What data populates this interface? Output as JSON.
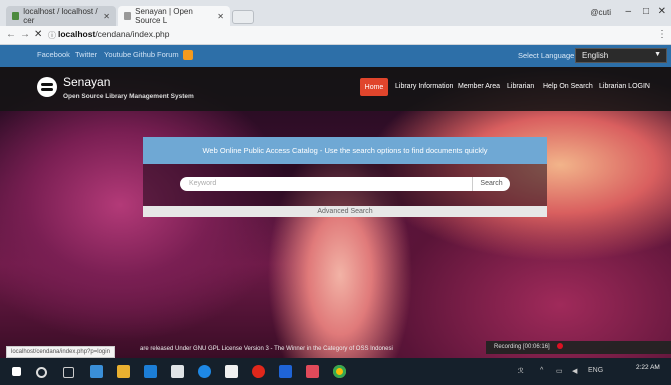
{
  "browser": {
    "tabs": [
      {
        "title": "localhost / localhost / cer"
      },
      {
        "title": "Senayan | Open Source L"
      }
    ],
    "user": "@cuti",
    "url": {
      "host": "localhost",
      "path": "/cendana/index.php"
    }
  },
  "social": {
    "links": [
      "Facebook",
      "Twitter",
      "Youtube",
      "Github",
      "Forum"
    ]
  },
  "language": {
    "label": "Select Language",
    "value": "English"
  },
  "header": {
    "brand": "Senayan",
    "tagline": "Open Source Library Management System",
    "nav": [
      "Home",
      "Library Information",
      "Member Area",
      "Librarian",
      "Help On Search",
      "Librarian LOGIN"
    ]
  },
  "search": {
    "heading": "Web Online Public Access Catalog - Use the search options to find documents quickly",
    "placeholder": "Keyword",
    "button": "Search",
    "advanced": "Advanced Search"
  },
  "status": {
    "url": "localhost/cendana/index.php?p=login"
  },
  "footer": {
    "text": "are released Under GNU GPL License Version 3 - The Winner in the Category of OSS Indonesi"
  },
  "recording": {
    "label": "Recording [00:06:16]"
  },
  "clock": {
    "time": "2:22 AM",
    "lang": "ENG"
  }
}
